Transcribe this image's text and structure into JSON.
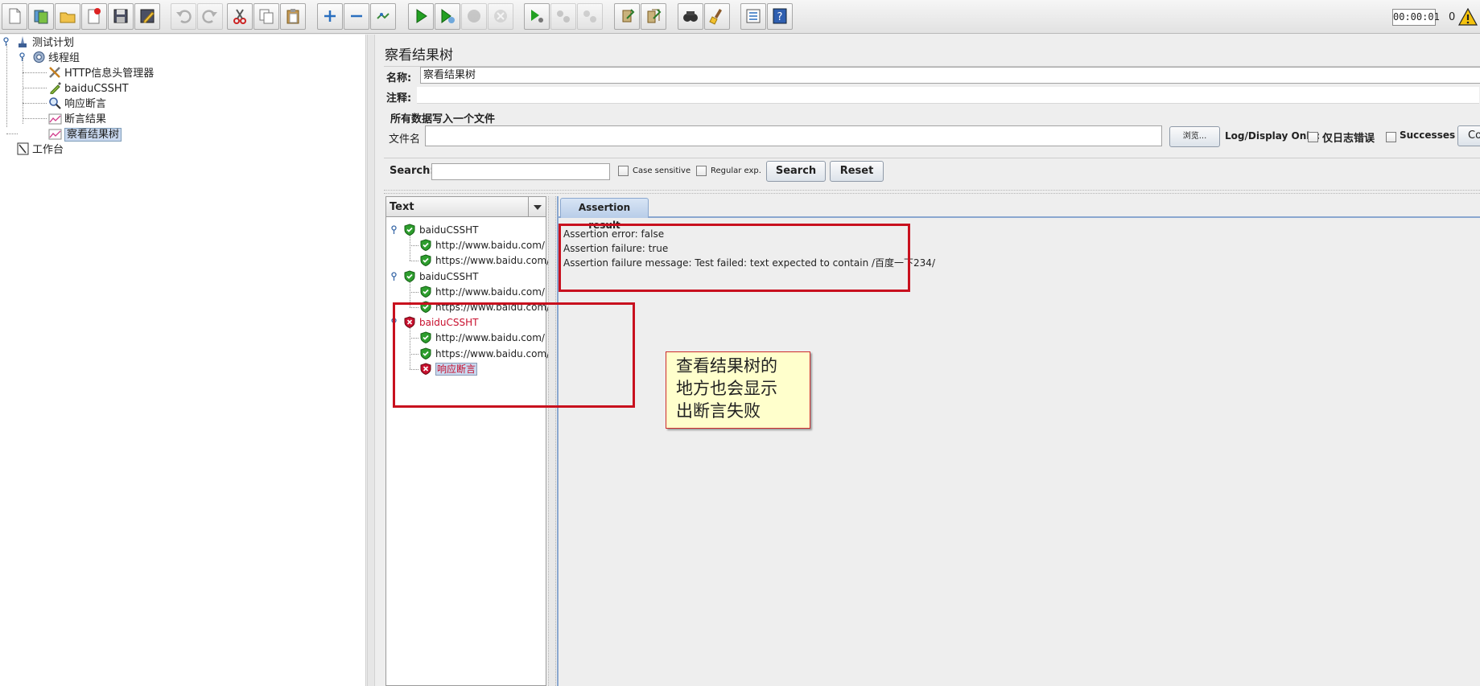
{
  "toolbar": {
    "timer": "00:00:01",
    "active_threads": "0",
    "buttons": [
      "new-icon",
      "templates-icon",
      "open-icon",
      "close-icon",
      "save-icon",
      "save-as-icon",
      "undo-icon",
      "redo-icon",
      "cut-icon",
      "copy-icon",
      "paste-icon",
      "expand-icon",
      "collapse-icon",
      "toggle-icon",
      "start-icon",
      "start-no-pauses-icon",
      "stop-icon",
      "shutdown-icon",
      "remote-start-icon",
      "remote-stop-icon",
      "remote-shutdown-icon",
      "clear-icon",
      "clear-all-icon",
      "search-icon",
      "reset-search-icon",
      "function-helper-icon",
      "help-icon"
    ]
  },
  "tree": {
    "test_plan": "测试计划",
    "thread_group": "线程组",
    "header_manager": "HTTP信息头管理器",
    "sampler": "baiduCSSHT",
    "response_assertion": "响应断言",
    "assertion_results": "断言结果",
    "view_results_tree": "察看结果树",
    "workbench": "工作台"
  },
  "panel": {
    "title": "察看结果树",
    "name_label": "名称:",
    "name_value": "察看结果树",
    "comment_label": "注释:",
    "comment_value": "",
    "file_group_title": "所有数据写入一个文件",
    "filename_label": "文件名",
    "filename_value": "",
    "browse_button": "浏览...",
    "log_display_label": "Log/Display Only:",
    "errors_only_label": "仅日志错误",
    "successes_label": "Successes",
    "configure_button": "Co"
  },
  "search": {
    "label": "Search:",
    "value": "",
    "case_sensitive": "Case sensitive",
    "regular_exp": "Regular exp.",
    "search_button": "Search",
    "reset_button": "Reset"
  },
  "results": {
    "renderer": "Text",
    "items": [
      {
        "label": "baiduCSSHT",
        "level": 0,
        "status": "pass"
      },
      {
        "label": "http://www.baidu.com/",
        "level": 1,
        "status": "pass"
      },
      {
        "label": "https://www.baidu.com/",
        "level": 1,
        "status": "pass"
      },
      {
        "label": "baiduCSSHT",
        "level": 0,
        "status": "pass"
      },
      {
        "label": "http://www.baidu.com/",
        "level": 1,
        "status": "pass"
      },
      {
        "label": "https://www.baidu.com/",
        "level": 1,
        "status": "pass"
      },
      {
        "label": "baiduCSSHT",
        "level": 0,
        "status": "fail"
      },
      {
        "label": "http://www.baidu.com/",
        "level": 1,
        "status": "pass"
      },
      {
        "label": "https://www.baidu.com/",
        "level": 1,
        "status": "pass"
      },
      {
        "label": "响应断言",
        "level": 1,
        "status": "fail"
      }
    ]
  },
  "assertion": {
    "tab_label": "Assertion result",
    "lines": [
      "Assertion error: false",
      "Assertion failure: true",
      "Assertion failure message: Test failed: text expected to contain /百度一下234/"
    ]
  },
  "annotation": {
    "lines": [
      "查看结果树的",
      "地方也会显示",
      "出断言失败"
    ]
  },
  "colors": {
    "annotation_red": "#c8101e",
    "note_bg": "#ffffcc",
    "fail_text": "#c8102e",
    "pass_green": "#2e9e2e",
    "tab_blue": "#8aa7cf"
  }
}
